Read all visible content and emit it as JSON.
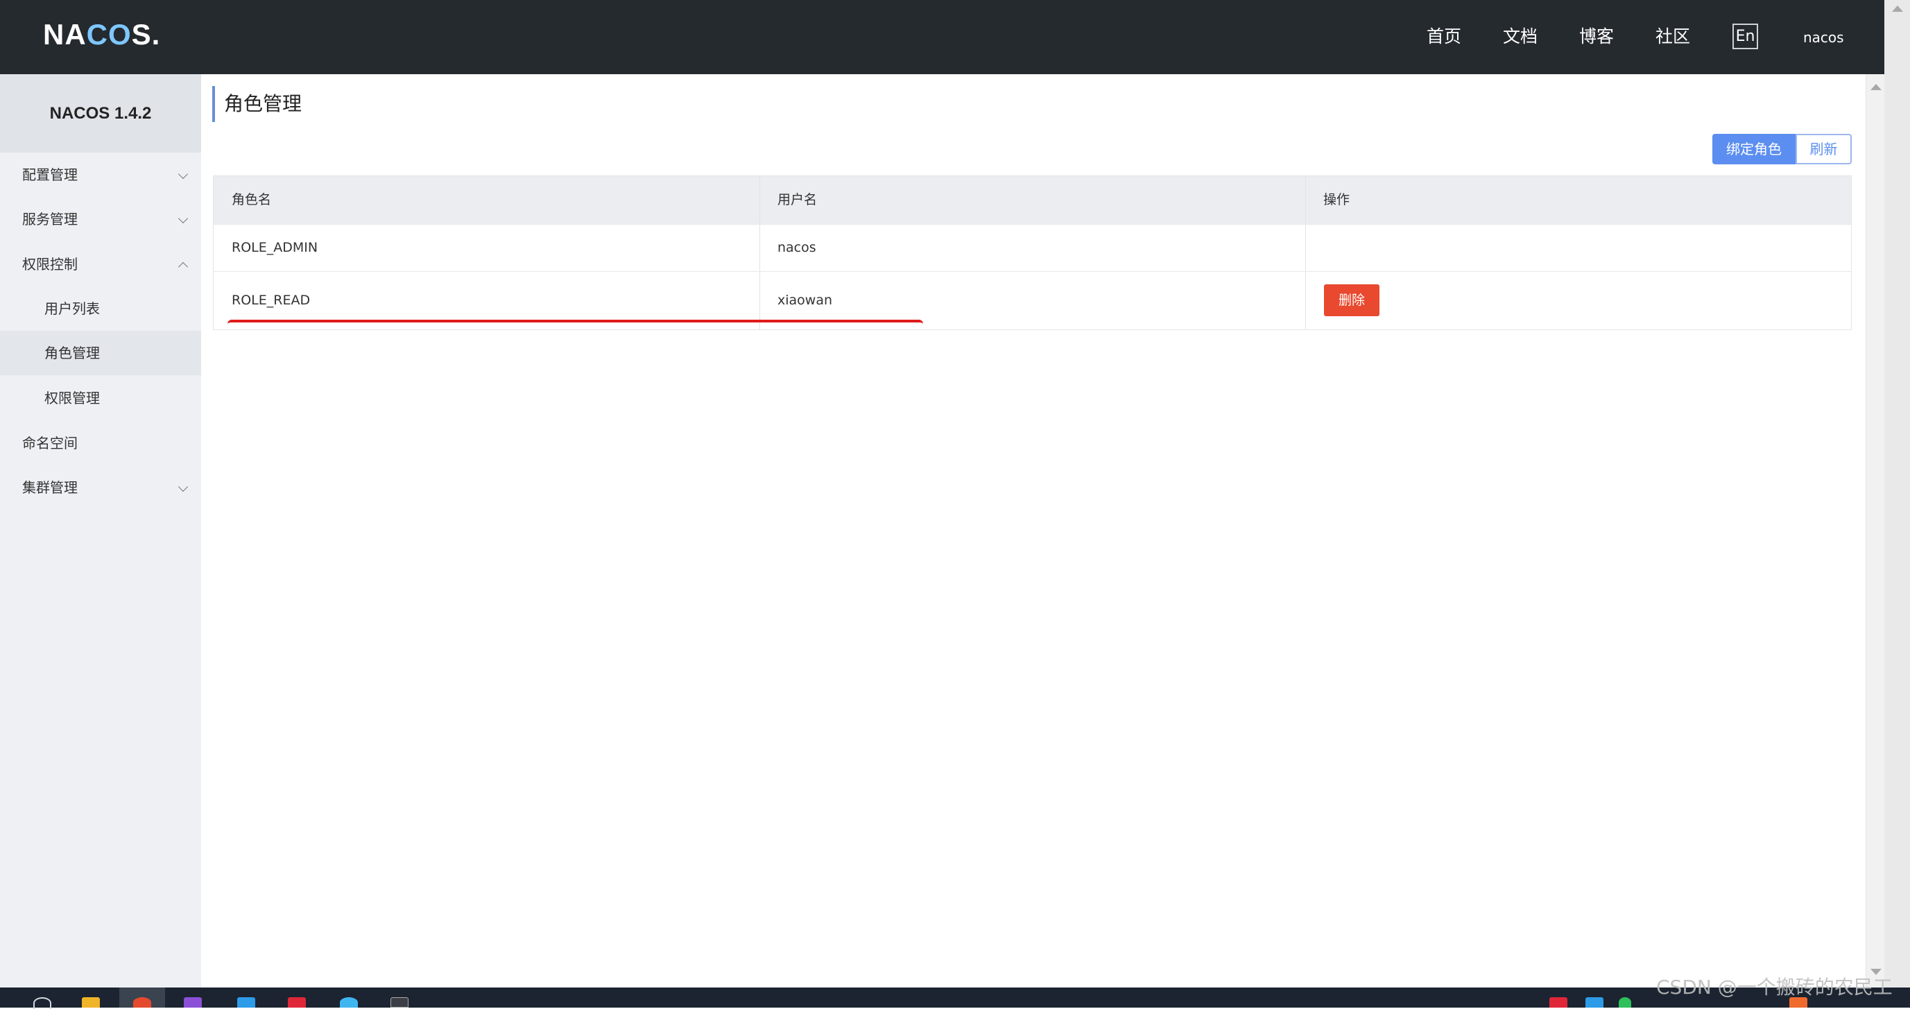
{
  "header": {
    "logo": "NACOS.",
    "nav": [
      "首页",
      "文档",
      "博客",
      "社区"
    ],
    "language": "En",
    "user": "nacos"
  },
  "sidebar": {
    "version": "NACOS 1.4.2",
    "items": [
      {
        "label": "配置管理",
        "expandable": true,
        "expanded": false
      },
      {
        "label": "服务管理",
        "expandable": true,
        "expanded": false
      },
      {
        "label": "权限控制",
        "expandable": true,
        "expanded": true
      },
      {
        "label": "用户列表",
        "sub": true
      },
      {
        "label": "角色管理",
        "sub": true,
        "active": true
      },
      {
        "label": "权限管理",
        "sub": true
      },
      {
        "label": "命名空间",
        "expandable": false
      },
      {
        "label": "集群管理",
        "expandable": true,
        "expanded": false
      }
    ]
  },
  "main": {
    "title": "角色管理",
    "bind_role_button": "绑定角色",
    "refresh_button": "刷新",
    "table": {
      "columns": [
        "角色名",
        "用户名",
        "操作"
      ],
      "rows": [
        {
          "role": "ROLE_ADMIN",
          "user": "nacos",
          "action": ""
        },
        {
          "role": "ROLE_READ",
          "user": "xiaowan",
          "action": "删除"
        }
      ]
    }
  },
  "watermark": "CSDN @一个搬砖的农民工",
  "colors": {
    "topbar": "#252a2f",
    "accent": "#5b8ef0",
    "danger": "#e8492f",
    "annotation": "#e01b1b"
  }
}
